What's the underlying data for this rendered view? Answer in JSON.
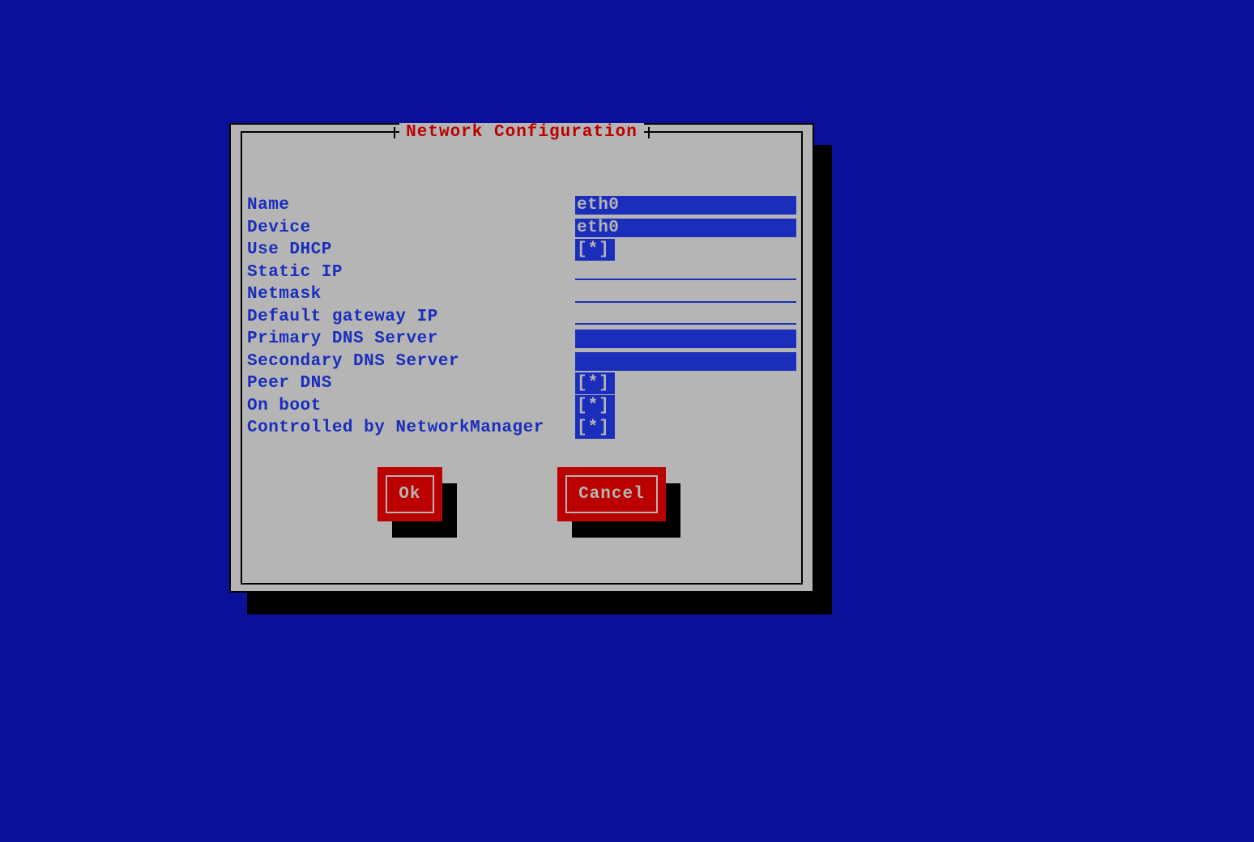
{
  "dialog": {
    "title": "Network Configuration",
    "fields": {
      "name": {
        "label": "Name",
        "value": "eth0",
        "type": "text"
      },
      "device": {
        "label": "Device",
        "value": "eth0",
        "type": "text"
      },
      "dhcp": {
        "label": "Use DHCP",
        "checked": true,
        "type": "check"
      },
      "static_ip": {
        "label": "Static IP",
        "value": "",
        "type": "line"
      },
      "netmask": {
        "label": "Netmask",
        "value": "",
        "type": "line"
      },
      "gateway": {
        "label": "Default gateway IP",
        "value": "",
        "type": "line"
      },
      "dns1": {
        "label": "Primary DNS Server",
        "value": "",
        "type": "text"
      },
      "dns2": {
        "label": "Secondary DNS Server",
        "value": "",
        "type": "text"
      },
      "peer_dns": {
        "label": "Peer DNS",
        "checked": true,
        "type": "check"
      },
      "on_boot": {
        "label": "On boot",
        "checked": true,
        "type": "check"
      },
      "nm_ctrl": {
        "label": "Controlled by NetworkManager",
        "checked": true,
        "type": "check"
      }
    },
    "buttons": {
      "ok": "Ok",
      "cancel": "Cancel"
    }
  }
}
